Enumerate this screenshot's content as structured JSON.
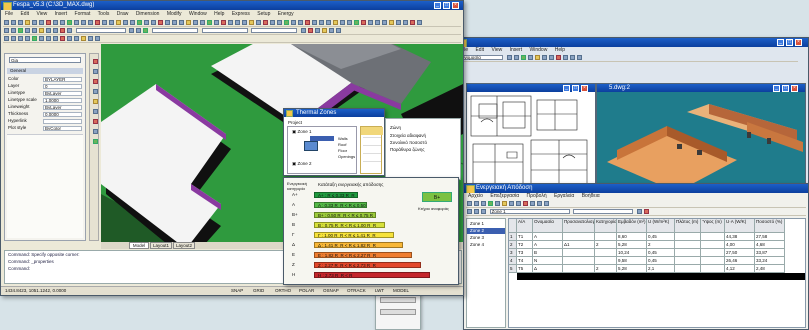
{
  "colors": {
    "model_green": "#2f9a3e",
    "block_white": "#f2f2f2",
    "block_grey": "#7b7e84",
    "titlebar_blue": "#1c5fc8",
    "close_red": "#d8503a",
    "selection_blue": "#3b5fb0",
    "classification_green": "#7bc142"
  },
  "icons": [
    "app-icon",
    "minimize-icon",
    "maximize-icon",
    "close-icon",
    "toolbar-icon",
    "layer-icon",
    "chevron-down-icon"
  ],
  "main_window": {
    "title": "Fespa_v5.3 (C:\\3D_MAX.dwg)",
    "menu": [
      "File",
      "Edit",
      "View",
      "Insert",
      "Format",
      "Tools",
      "Draw",
      "Dimension",
      "Modify",
      "Window",
      "Help",
      "Express",
      "Setup",
      "Energy"
    ],
    "properties_panel": {
      "selector": "Gia",
      "section": "General",
      "rows": [
        {
          "key": "Color",
          "value": "BYLAYER"
        },
        {
          "key": "Layer",
          "value": "0"
        },
        {
          "key": "Linetype",
          "value": "ByLayer"
        },
        {
          "key": "Linetype scale",
          "value": "1.0000"
        },
        {
          "key": "Lineweight",
          "value": "ByLayer"
        },
        {
          "key": "Thickness",
          "value": "0.0000"
        },
        {
          "key": "Hyperlink",
          "value": ""
        },
        {
          "key": "Plot style",
          "value": "ByColor"
        }
      ]
    },
    "tabs": [
      "Model",
      "Layout1",
      "Layout2"
    ],
    "command_lines": [
      "Command: Specify opposite corner:",
      "Command: _properties",
      "Command:"
    ],
    "status_text": "1434.8423, 1051.1242, 0.0000",
    "status_buttons": [
      "SNAP",
      "GRID",
      "ORTHO",
      "POLAR",
      "OSNAP",
      "OTRACK",
      "LWT",
      "MODEL"
    ]
  },
  "dialog": {
    "title": "Thermal Zones",
    "tree_root": "Project",
    "tree_nodes": [
      "Zone 1",
      "Zone 2"
    ],
    "list_items": [
      "Walls",
      "Roof",
      "Floor",
      "Openings"
    ],
    "right_items": [
      "Ζώνη",
      "Στοιχεία αδιαφανή",
      "Συνολικό ποσοστό",
      "Παράθυρα ζώνης"
    ],
    "scale_heading": "Κατάταξη ενεργειακής απόδοσης",
    "scale_left_label": "Ενεργειακή κατηγορία",
    "badge": "B+",
    "badge_note": "Κτήριο αναφοράς",
    "classes": [
      {
        "cls": "A+",
        "label": "A+ : R ≤ 0,33 R_R",
        "color": "#1f9a3e"
      },
      {
        "cls": "A",
        "label": "A : 0,33 R_R < R ≤ 0,50 R_R",
        "color": "#54b947"
      },
      {
        "cls": "B+",
        "label": "B+ : 0,50 R_R < R ≤ 0,75 R_R",
        "color": "#9ccb3b"
      },
      {
        "cls": "B",
        "label": "B : 0,75 R_R < R ≤ 1,00 R_R",
        "color": "#d6e03a"
      },
      {
        "cls": "Γ",
        "label": "Γ : 1,00 R_R < R ≤ 1,41 R_R",
        "color": "#f6e23a"
      },
      {
        "cls": "Δ",
        "label": "Δ : 1,41 R_R < R ≤ 1,82 R_R",
        "color": "#f8b737"
      },
      {
        "cls": "Ε",
        "label": "Ε : 1,82 R_R < R ≤ 2,27 R_R",
        "color": "#ef7d2f"
      },
      {
        "cls": "Ζ",
        "label": "Ζ : 2,27 R_R < R ≤ 2,73 R_R",
        "color": "#e2472a"
      },
      {
        "cls": "Η",
        "label": "Η : 2,73 R_R < R",
        "color": "#c4262b"
      }
    ]
  },
  "back_window": {
    "menu": [
      "File",
      "Edit",
      "View",
      "Insert",
      "Window",
      "Help"
    ],
    "combo": "Ονομασία",
    "drawing_window_title": "5.dwg:2"
  },
  "table_window": {
    "title": "Ενεργειακή Απόδοση",
    "menu": [
      "Αρχείο",
      "Επεξεργασία",
      "Προβολή",
      "Εργαλεία",
      "Βοήθεια"
    ],
    "combo": "Zone 1",
    "tree_items": [
      "Zone 1",
      "Zone 2",
      "Zone 3",
      "Zone 4"
    ],
    "headers": [
      "",
      "Α/Α",
      "Ονομασία",
      "Προσανατολισμός",
      "Κατηγορία",
      "Εμβαδόν (m²)",
      "U (W/m²K)",
      "Πλάτος (m)",
      "Ύψος (m)",
      "U·A (W/K)",
      "Ποσοστό (%)"
    ],
    "rows": [
      [
        "1",
        "Τ1",
        "A",
        "",
        "",
        "8,60",
        "0,45",
        "",
        "",
        "44,38",
        "27,58"
      ],
      [
        "2",
        "Τ2",
        "A",
        "Δ1",
        "2",
        "5,28",
        "2",
        "",
        "",
        "4,00",
        "4,68"
      ],
      [
        "3",
        "Τ3",
        "B",
        "",
        "",
        "10,24",
        "0,45",
        "",
        "",
        "27,50",
        "33,87"
      ],
      [
        "4",
        "Τ4",
        "N",
        "",
        "",
        "9,58",
        "0,45",
        "",
        "",
        "26,46",
        "33,24"
      ],
      [
        "5",
        "Τ5",
        "Δ",
        "",
        "2",
        "5,28",
        "2,1",
        "",
        "",
        "4,12",
        "2,48"
      ]
    ]
  }
}
